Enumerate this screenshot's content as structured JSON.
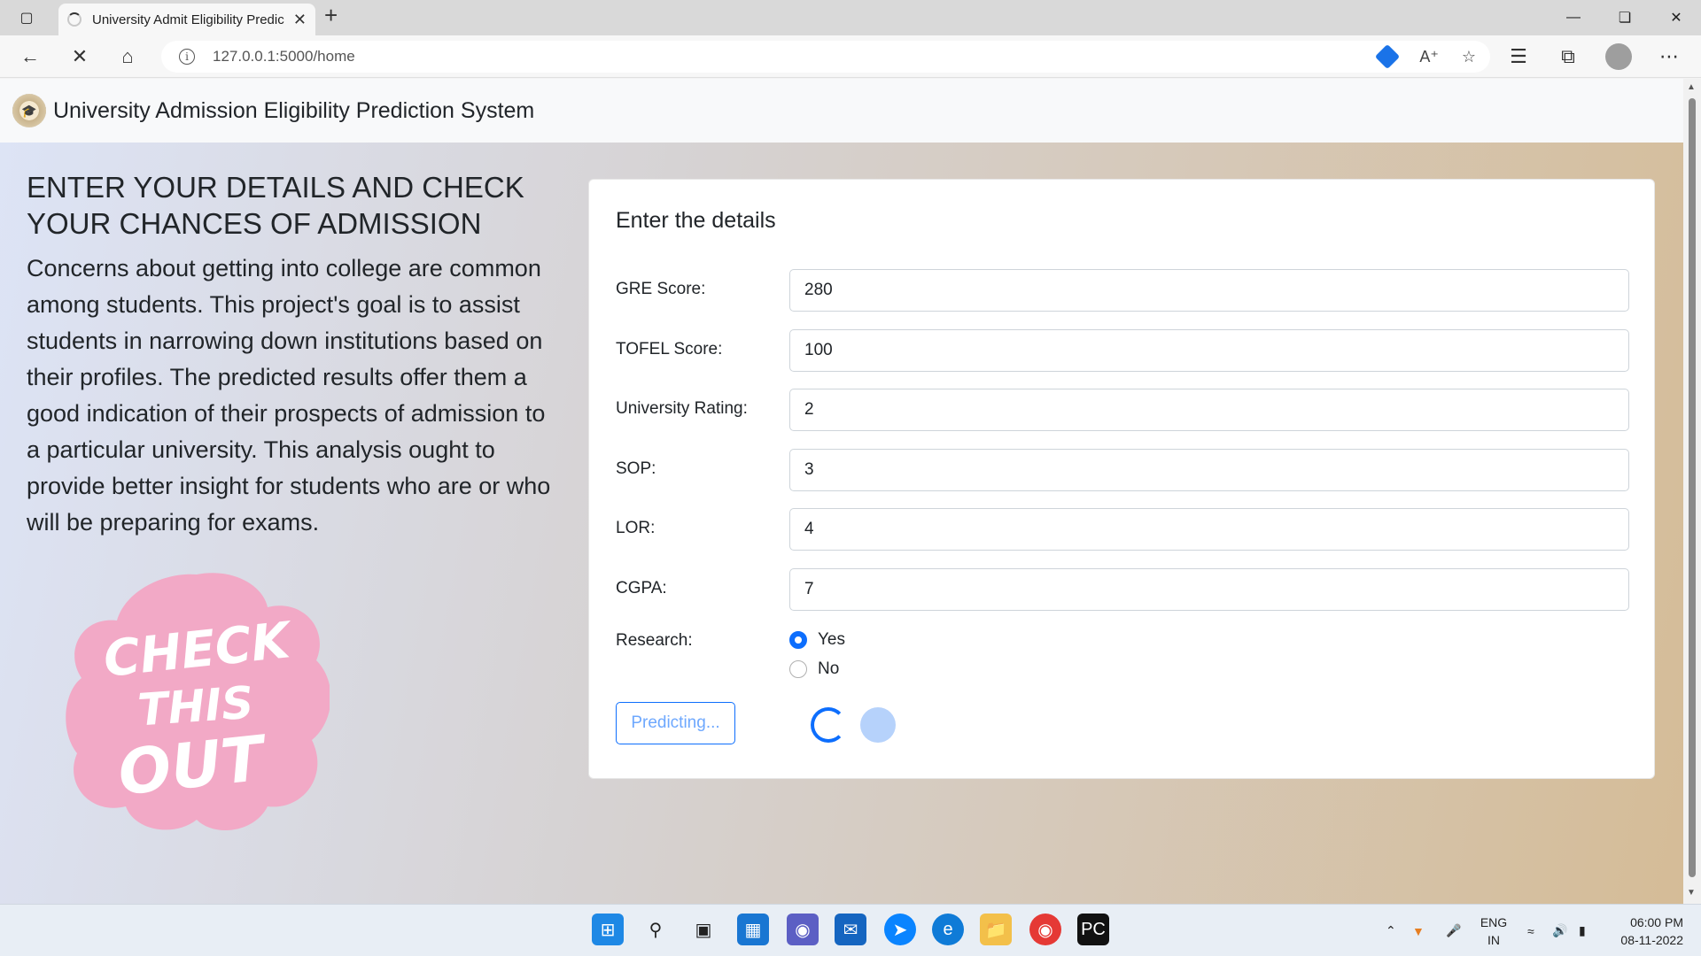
{
  "browser": {
    "tab_title": "University Admit Eligibility Predic",
    "new_tab_symbol": "+",
    "url": "127.0.0.1:5000/home"
  },
  "site": {
    "brand": "University Admission Eligibility Prediction System"
  },
  "hero": {
    "title": "ENTER YOUR DETAILS AND CHECK YOUR CHANCES OF ADMISSION",
    "text": "Concerns about getting into college are common among students. This project's goal is to assist students in narrowing down institutions based on their profiles. The predicted results offer them a good indication of their prospects of admission to a particular university. This analysis ought to provide better insight for students who are or who will be preparing for exams."
  },
  "sticker": {
    "text": "CHECK THIS OUT",
    "color": "#f2a9c6"
  },
  "form": {
    "title": "Enter the details",
    "fields": [
      {
        "label": "GRE Score:",
        "value": "280"
      },
      {
        "label": "TOFEL Score:",
        "value": "100"
      },
      {
        "label": "University Rating:",
        "value": "2"
      },
      {
        "label": "SOP:",
        "value": "3"
      },
      {
        "label": "LOR:",
        "value": "4"
      },
      {
        "label": "CGPA:",
        "value": "7"
      }
    ],
    "research": {
      "label": "Research:",
      "options": [
        "Yes",
        "No"
      ],
      "selected": "Yes"
    },
    "button_label": "Predicting...",
    "accent": "#0d6efd"
  },
  "taskbar": {
    "lang": "ENG",
    "region": "IN",
    "time": "06:00 PM",
    "date": "08-11-2022"
  }
}
